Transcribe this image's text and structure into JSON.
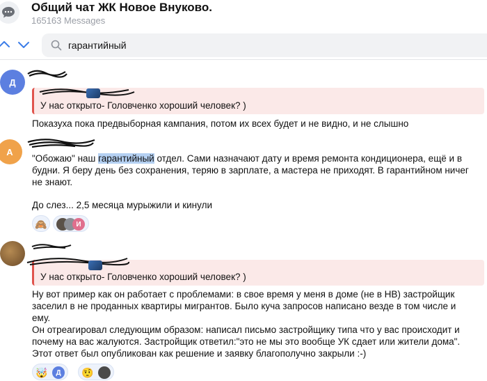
{
  "header": {
    "title": "Общий чат ЖК Новое Внуково.",
    "subtitle": "165163 Messages",
    "chat_icon": "speech-bubble-icon"
  },
  "search": {
    "value": "гарантийный",
    "up_icon": "chevron-up-icon",
    "down_icon": "chevron-down-icon",
    "search_icon": "search-icon"
  },
  "colors": {
    "accent": "#3b7de8",
    "reply_bar": "#e0544d",
    "reply_bg": "#fbe9e8",
    "highlight": "#b4d0f2",
    "avatar_d": "#5c7fe0",
    "avatar_a": "#f0a24a"
  },
  "messages": [
    {
      "avatar_letter": "Д",
      "reply_text": "У нас открыто- Головченко хороший человек? )",
      "lines": [
        "Показуха пока предвыборная кампания, потом их всех будет и не видно, и не слышно"
      ]
    },
    {
      "avatar_letter": "А",
      "line1_before": "\"Обожаю\" наш ",
      "line1_highlight": "гарантийный",
      "line1_after": " отдел. Сами назначают дату и время ремонта кондиционера, ещё и в",
      "line2": "будни. Я беру день без сохранения, теряю в зарплате, а мастера не приходят. В гарантийном ничег",
      "line3": "не знают.",
      "line4": "До слез... 2,5 месяца мурыжили и кинули",
      "reactions": [
        {
          "emoji": "🙈"
        },
        {
          "avatars": [
            "photo",
            "photo",
            "И"
          ]
        }
      ]
    },
    {
      "avatar_letter": "",
      "reply_text": "У нас открыто- Головченко хороший человек? )",
      "lines": [
        "Ну вот пример как он работает с проблемами: в свое время у меня в доме (не в НВ) застройщик",
        "заселил в не проданных квартиры мигрантов. Было куча запросов написано везде в том числе и",
        "ему.",
        "Он отреагировал следующим образом: написал письмо застройщику типа что у вас происходит и",
        "почему на вас жалуются. Застройщик ответил:\"это не мы это вообще УК сдает или жители дома\".",
        "Этот ответ был опубликован как решение и заявку благополучно закрыли :-)"
      ],
      "reactions": [
        {
          "emoji": "🤯",
          "avatar": "Д"
        },
        {
          "emoji": "🤨",
          "avatar": "photo"
        }
      ]
    }
  ]
}
